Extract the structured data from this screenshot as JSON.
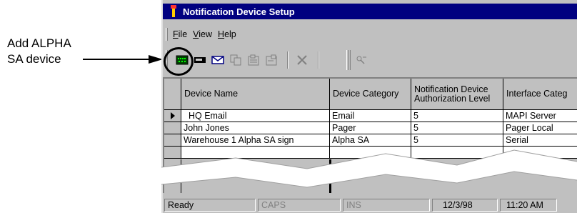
{
  "callout": {
    "line1": "Add ALPHA",
    "line2": "SA device"
  },
  "window": {
    "title": "Notification Device Setup"
  },
  "menu": [
    {
      "label": "File",
      "key": "F",
      "rest": "ile"
    },
    {
      "label": "View",
      "key": "V",
      "rest": "iew"
    },
    {
      "label": "Help",
      "key": "H",
      "rest": "elp"
    }
  ],
  "toolbar": {
    "icons": [
      "add-alpha-sa-device-icon",
      "pager-icon",
      "email-icon",
      "copy-icon",
      "properties-icon",
      "properties-alt-icon",
      "delete-icon",
      "find-icon"
    ]
  },
  "grid": {
    "columns": [
      "Device Name",
      "Device Category",
      "Notification Device Authorization Level",
      "Interface Categ"
    ],
    "rows": [
      [
        "HQ Email",
        "Email",
        "5",
        "MAPI Server"
      ],
      [
        "John Jones",
        "Pager",
        "5",
        "Pager Local"
      ],
      [
        "Warehouse 1 Alpha SA sign",
        "Alpha SA",
        "5",
        "Serial"
      ]
    ]
  },
  "status": {
    "ready": "Ready",
    "caps": "CAPS",
    "ins": "INS",
    "date": "12/3/98",
    "time": "11:20 AM"
  },
  "colors": {
    "titlebar": "#000080",
    "chrome": "#c0c0c0",
    "accent_green": "#008000"
  }
}
